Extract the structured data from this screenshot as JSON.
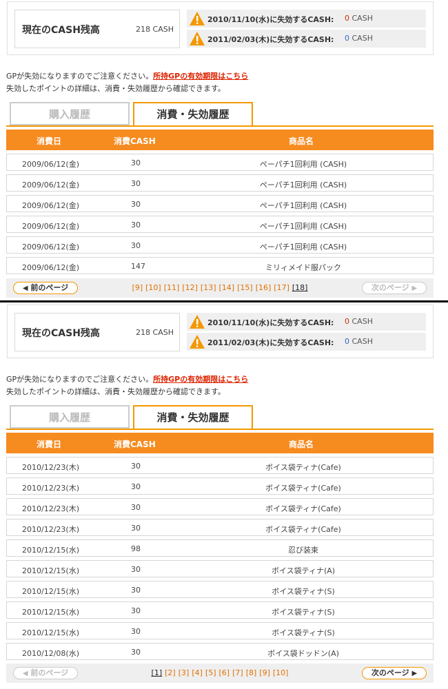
{
  "top": {
    "balance": {
      "label": "現在のCASH残高",
      "value": "218 CASH"
    },
    "expire": [
      {
        "label": "2010/11/10(水)に失効するCASH:",
        "num": "0",
        "unit": "CASH"
      },
      {
        "label": "2011/02/03(木)に失効するCASH:",
        "num": "0",
        "unit": "CASH"
      }
    ],
    "notice": {
      "line1": "GPが失効になりますのでご注意ください。",
      "link": "所持GPの有効期限はこちら",
      "line2": "失効したポイントの詳細は、消費・失効履歴から確認できます。"
    },
    "tabs": {
      "inactive": "購入履歴",
      "active": "消費・失効履歴"
    },
    "headers": {
      "date": "消費日",
      "cash": "消費CASH",
      "item": "商品名"
    },
    "rows": [
      {
        "date": "2009/06/12(金)",
        "cash": "30",
        "item": "ペーパチ1回利用 (CASH)"
      },
      {
        "date": "2009/06/12(金)",
        "cash": "30",
        "item": "ペーパチ1回利用 (CASH)"
      },
      {
        "date": "2009/06/12(金)",
        "cash": "30",
        "item": "ペーパチ1回利用 (CASH)"
      },
      {
        "date": "2009/06/12(金)",
        "cash": "30",
        "item": "ペーパチ1回利用 (CASH)"
      },
      {
        "date": "2009/06/12(金)",
        "cash": "30",
        "item": "ペーパチ1回利用 (CASH)"
      },
      {
        "date": "2009/06/12(金)",
        "cash": "147",
        "item": "ミリィメイド服パック"
      }
    ],
    "pager": {
      "prev": "前のページ",
      "next": "次のページ",
      "pages": [
        "[9]",
        "[10]",
        "[11]",
        "[12]",
        "[13]",
        "[14]",
        "[15]",
        "[16]",
        "[17]",
        "[18]"
      ],
      "current": 9
    }
  },
  "bottom": {
    "balance": {
      "label": "現在のCASH残高",
      "value": "218 CASH"
    },
    "expire": [
      {
        "label": "2010/11/10(水)に失効するCASH:",
        "num": "0",
        "unit": "CASH"
      },
      {
        "label": "2011/02/03(木)に失効するCASH:",
        "num": "0",
        "unit": "CASH"
      }
    ],
    "notice": {
      "line1": "GPが失効になりますのでご注意ください。",
      "link": "所持GPの有効期限はこちら",
      "line2": "失効したポイントの詳細は、消費・失効履歴から確認できます。"
    },
    "tabs": {
      "inactive": "購入履歴",
      "active": "消費・失効履歴"
    },
    "headers": {
      "date": "消費日",
      "cash": "消費CASH",
      "item": "商品名"
    },
    "rows": [
      {
        "date": "2010/12/23(木)",
        "cash": "30",
        "item": "ボイス袋ティナ(Cafe)"
      },
      {
        "date": "2010/12/23(木)",
        "cash": "30",
        "item": "ボイス袋ティナ(Cafe)"
      },
      {
        "date": "2010/12/23(木)",
        "cash": "30",
        "item": "ボイス袋ティナ(Cafe)"
      },
      {
        "date": "2010/12/23(木)",
        "cash": "30",
        "item": "ボイス袋ティナ(Cafe)"
      },
      {
        "date": "2010/12/15(水)",
        "cash": "98",
        "item": "忍び装束"
      },
      {
        "date": "2010/12/15(水)",
        "cash": "30",
        "item": "ボイス袋ティナ(A)"
      },
      {
        "date": "2010/12/15(水)",
        "cash": "30",
        "item": "ボイス袋ティナ(S)"
      },
      {
        "date": "2010/12/15(水)",
        "cash": "30",
        "item": "ボイス袋ティナ(S)"
      },
      {
        "date": "2010/12/15(水)",
        "cash": "30",
        "item": "ボイス袋ティナ(S)"
      },
      {
        "date": "2010/12/08(水)",
        "cash": "30",
        "item": "ボイス袋ドッドン(A)"
      }
    ],
    "pager": {
      "prev": "前のページ",
      "next": "次のページ",
      "pages": [
        "[1]",
        "[2]",
        "[3]",
        "[4]",
        "[5]",
        "[6]",
        "[7]",
        "[8]",
        "[9]",
        "[10]"
      ],
      "current": 0
    }
  },
  "colors": {
    "accent": "#f68b1f",
    "tab_border": "#f39800",
    "warn": "#f39800",
    "link": "#dd2200"
  },
  "icons": {
    "warning": "warning-icon",
    "prev_arrow": "chevron-left-icon",
    "next_arrow": "chevron-right-icon"
  }
}
